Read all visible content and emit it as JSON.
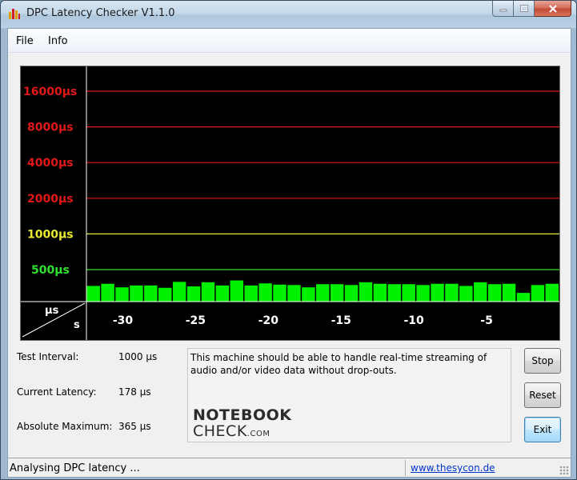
{
  "window": {
    "title": "DPC Latency Checker V1.1.0"
  },
  "menu": {
    "items": [
      "File",
      "Info"
    ]
  },
  "chart_data": {
    "type": "bar",
    "y_scale": "log",
    "y_unit_label": "µs",
    "x_unit_label": "s",
    "reference_lines": [
      {
        "label": "16000µs",
        "value": 16000,
        "color": "#e01818"
      },
      {
        "label": "8000µs",
        "value": 8000,
        "color": "#e01818"
      },
      {
        "label": "4000µs",
        "value": 4000,
        "color": "#e01818"
      },
      {
        "label": "2000µs",
        "value": 2000,
        "color": "#e01818"
      },
      {
        "label": "1000µs",
        "value": 1000,
        "color": "#e8e830"
      },
      {
        "label": "500µs",
        "value": 500,
        "color": "#30e030"
      }
    ],
    "x_ticks": [
      -30,
      -25,
      -20,
      -15,
      -10,
      -5
    ],
    "x_range": [
      -32.5,
      0
    ],
    "bar_color": "#00f000",
    "values": [
      220,
      245,
      205,
      225,
      225,
      200,
      270,
      215,
      265,
      225,
      290,
      225,
      250,
      235,
      230,
      205,
      240,
      240,
      230,
      265,
      245,
      240,
      240,
      230,
      245,
      245,
      220,
      265,
      240,
      245,
      155,
      230,
      245
    ]
  },
  "stats": {
    "test_interval_label": "Test Interval:",
    "test_interval_value": "1000 µs",
    "current_latency_label": "Current Latency:",
    "current_latency_value": "178 µs",
    "absolute_maximum_label": "Absolute Maximum:",
    "absolute_maximum_value": "365 µs"
  },
  "message": "This machine should be able to handle real-time streaming of audio and/or video data without drop-outs.",
  "logo": {
    "line1": "NOTEBOOK",
    "line2": "CHECK",
    "line2_suffix": ".COM"
  },
  "buttons": {
    "stop": "Stop",
    "reset": "Reset",
    "exit": "Exit"
  },
  "status": {
    "text": "Analysing DPC latency ...",
    "link": "www.thesycon.de"
  }
}
